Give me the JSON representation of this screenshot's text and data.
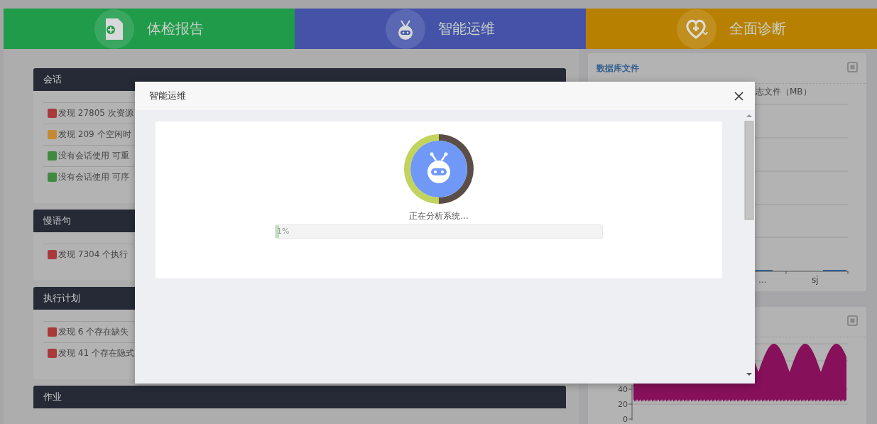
{
  "top_nav": [
    {
      "label": "体检报告",
      "color": "#1f9b4a"
    },
    {
      "label": "智能运维",
      "color": "#4453a8"
    },
    {
      "label": "全面诊断",
      "color": "#b88000"
    }
  ],
  "sections": [
    {
      "title": "会话",
      "items": [
        {
          "text": "发现 27805 次资源",
          "color": "#a83a3a"
        },
        {
          "text": "发现 209 个空闲时",
          "color": "#c68a34"
        },
        {
          "text": "没有会话使用 可重",
          "color": "#3f8a3f"
        },
        {
          "text": "没有会话使用 可序",
          "color": "#3f8a3f"
        }
      ]
    },
    {
      "title": "慢语句",
      "items": [
        {
          "text": "发现 7304 个执行",
          "color": "#a83a3a"
        }
      ]
    },
    {
      "title": "执行计划",
      "items": [
        {
          "text": "发现 6 个存在缺失",
          "color": "#a83a3a"
        },
        {
          "text": "发现 41 个存在隐式",
          "color": "#a83a3a"
        }
      ]
    },
    {
      "title": "作业"
    }
  ],
  "right_panels": [
    {
      "kind": "bars",
      "title": "数据库文件",
      "legend": "志文件（MB）",
      "x_labels": [
        "...",
        "sj"
      ]
    },
    {
      "kind": "wave",
      "y_ticks": [
        "40",
        "20",
        "0"
      ]
    }
  ],
  "modal": {
    "title": "智能运维",
    "status": "正在分析系统...",
    "progress": {
      "level": 0.01,
      "label": "1%"
    }
  }
}
